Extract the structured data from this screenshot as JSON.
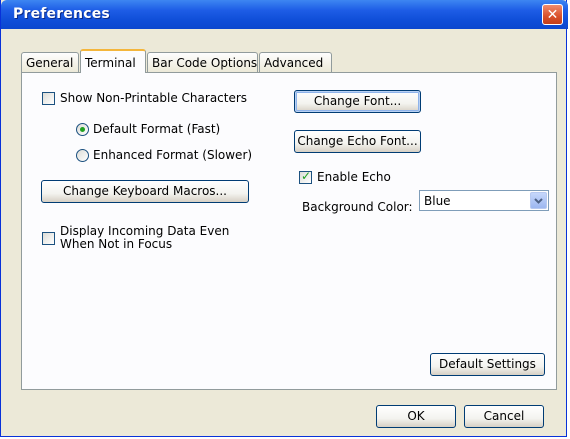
{
  "window": {
    "title": "Preferences",
    "close_glyph": "✕"
  },
  "tabs": [
    {
      "label": "General"
    },
    {
      "label": "Terminal"
    },
    {
      "label": "Bar Code Options"
    },
    {
      "label": "Advanced"
    }
  ],
  "terminal": {
    "show_nonprintable": {
      "label": "Show Non-Printable Characters",
      "checked": false
    },
    "format_default": {
      "label": "Default Format (Fast)",
      "selected": true
    },
    "format_enhanced": {
      "label": "Enhanced Format (Slower)",
      "selected": false
    },
    "change_macros_label": "Change Keyboard Macros...",
    "display_incoming": {
      "label_line1": "Display Incoming Data Even",
      "label_line2": "When Not in Focus",
      "checked": false
    },
    "change_font_label": "Change Font...",
    "change_echo_font_label": "Change Echo Font...",
    "enable_echo": {
      "label": "Enable Echo",
      "checked": true
    },
    "background_color": {
      "label": "Background Color:",
      "value": "Blue"
    },
    "default_settings_label": "Default Settings"
  },
  "footer": {
    "ok_label": "OK",
    "cancel_label": "Cancel"
  },
  "icons": {
    "close": "close-icon",
    "checkmark": "checkmark-icon",
    "dropdown": "chevron-down-icon"
  }
}
